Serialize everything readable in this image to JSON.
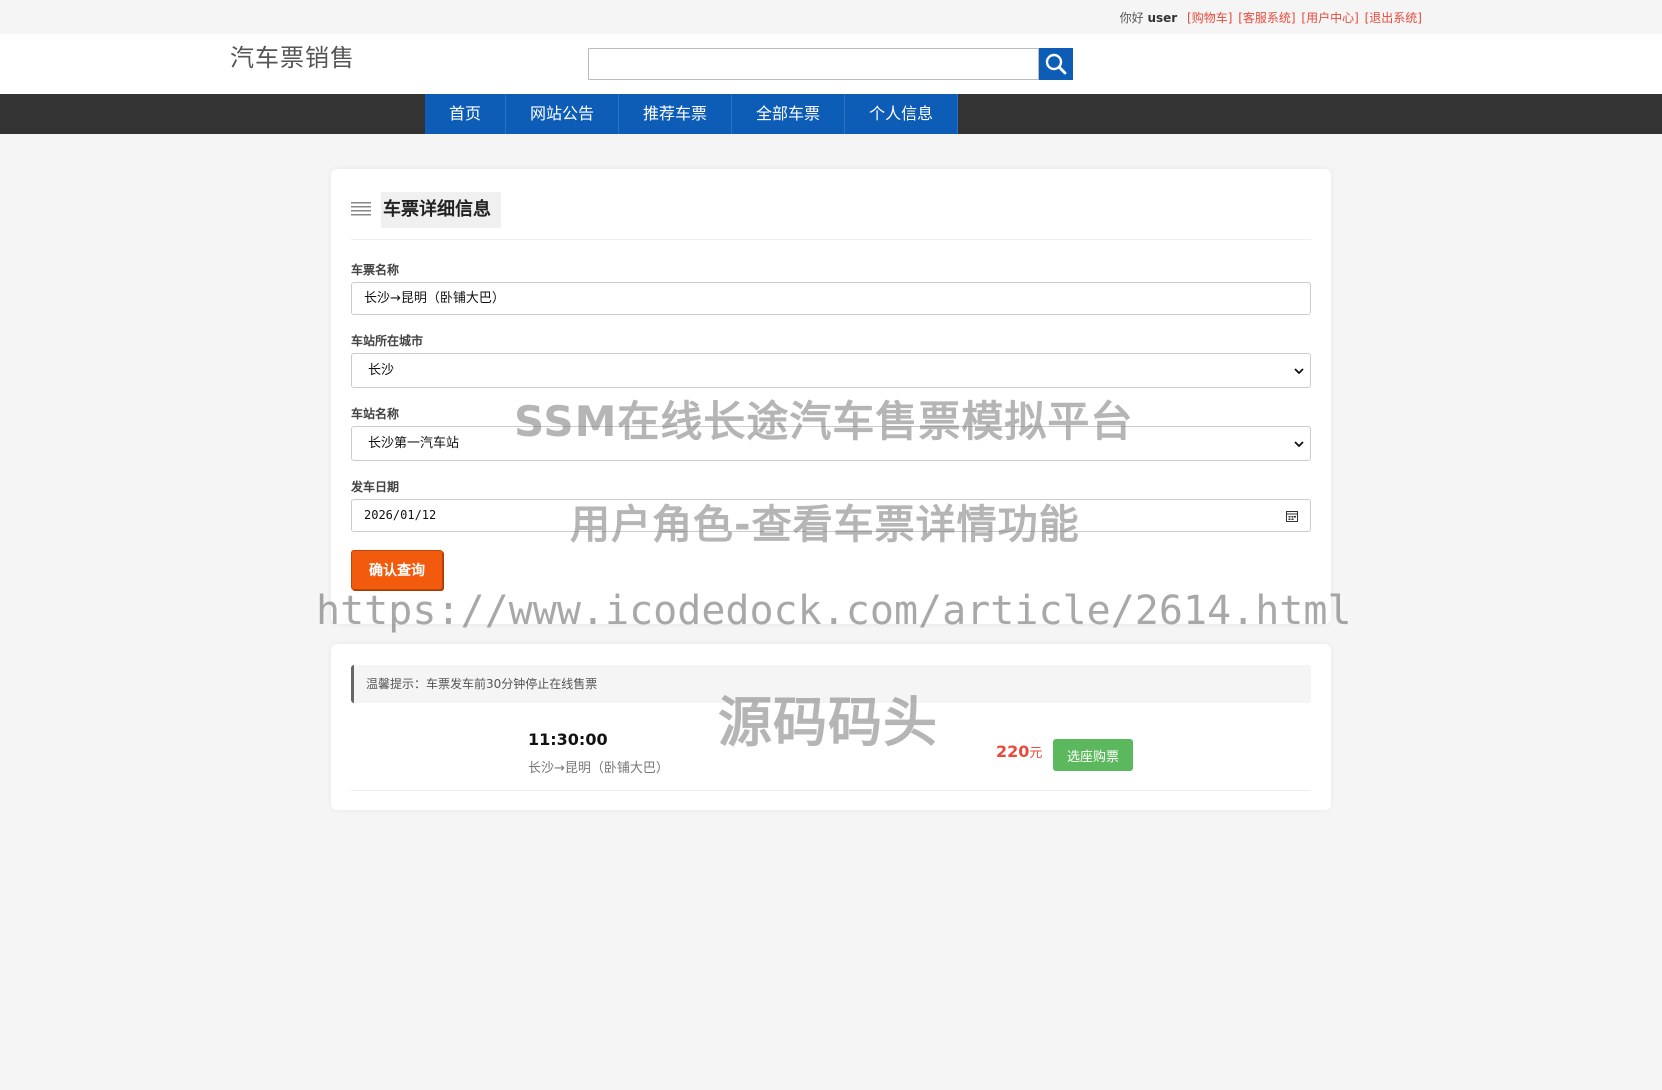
{
  "topbar": {
    "greeting": "你好",
    "username": "user",
    "links": [
      "[购物车]",
      "[客服系统]",
      "[用户中心]",
      "[退出系统]"
    ]
  },
  "header": {
    "logo": "汽车票销售",
    "search_value": ""
  },
  "nav": [
    "首页",
    "网站公告",
    "推荐车票",
    "全部车票",
    "个人信息"
  ],
  "detail": {
    "title": "车票详细信息",
    "fields": {
      "name_label": "车票名称",
      "name_value": "长沙→昆明（卧铺大巴）",
      "city_label": "车站所在城市",
      "city_value": "长沙",
      "station_label": "车站名称",
      "station_value": "长沙第一汽车站",
      "date_label": "发车日期",
      "date_value": "2026/01/12"
    },
    "confirm_label": "确认查询"
  },
  "tickets": {
    "tip": "温馨提示：车票发车前30分钟停止在线售票",
    "items": [
      {
        "time": "11:30:00",
        "route": "长沙→昆明（卧铺大巴）",
        "price": "220",
        "unit": "元",
        "buy_label": "选座购票"
      }
    ]
  },
  "watermark": {
    "line1": "SSM在线长途汽车售票模拟平台",
    "line2": "用户角色-查看车票详情功能",
    "line3": "https://www.icodedock.com/article/2614.html",
    "line4": "源码码头"
  },
  "colors": {
    "primary_blue": "#0d5cb6",
    "nav_dark": "#333333",
    "orange": "#f25a0e",
    "red": "#e84b3c",
    "green": "#5cb85c"
  }
}
